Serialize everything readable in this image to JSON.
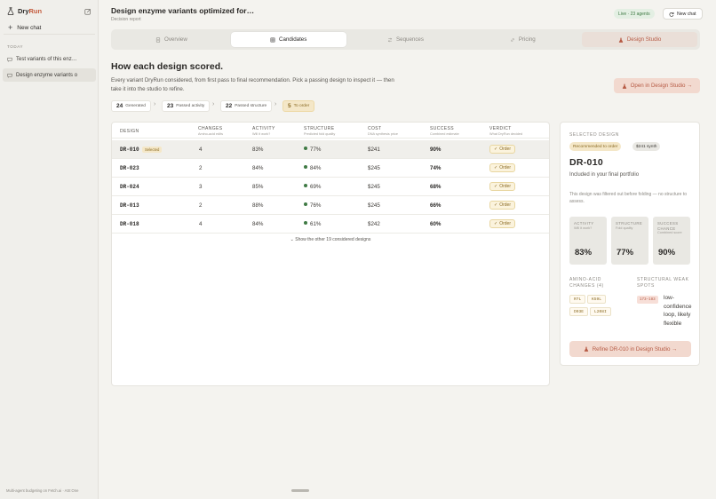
{
  "app": {
    "name_prefix": "Dry",
    "name_suffix": "Run",
    "new_chat": "New chat",
    "today_label": "TODAY",
    "history": [
      {
        "label": "Test variants of this enz…"
      },
      {
        "label": "Design enzyme variants o"
      }
    ],
    "footer": "Multi-agent budgeting on Fetch.ai · ASI:One"
  },
  "header": {
    "title": "Design enzyme variants optimized for…",
    "subtitle": "Decision report",
    "live_badge": "Live · 23 agents",
    "new_chat": "New chat"
  },
  "tabs": [
    {
      "label": "Overview",
      "icon": "document-icon"
    },
    {
      "label": "Candidates",
      "icon": "grid-icon"
    },
    {
      "label": "Sequences",
      "icon": "swap-icon"
    },
    {
      "label": "Pricing",
      "icon": "link-icon"
    },
    {
      "label": "Design Studio",
      "icon": "flask-icon"
    }
  ],
  "section": {
    "heading": "How each design scored.",
    "description": "Every variant DryRun considered, from first pass to final recommendation. Pick a passing design to inspect it — then take it into the studio to refine.",
    "open_studio": "Open in Design Studio →"
  },
  "funnel": [
    {
      "count": "24",
      "label": "Generated"
    },
    {
      "count": "23",
      "label": "Passed activity"
    },
    {
      "count": "22",
      "label": "Passed structure"
    },
    {
      "count": "5",
      "label": "To order"
    }
  ],
  "table": {
    "columns": [
      {
        "label": "DESIGN",
        "sub": ""
      },
      {
        "label": "CHANGES",
        "sub": "Amino-acid edits"
      },
      {
        "label": "ACTIVITY",
        "sub": "Will it work?"
      },
      {
        "label": "STRUCTURE",
        "sub": "Predicted fold quality"
      },
      {
        "label": "COST",
        "sub": "DNA synthesis price"
      },
      {
        "label": "SUCCESS",
        "sub": "Combined estimate"
      },
      {
        "label": "VERDICT",
        "sub": "What DryRun decided"
      }
    ],
    "selected_badge": "Selected",
    "rows": [
      {
        "id": "DR-010",
        "changes": "4",
        "activity": "83%",
        "structure": "77%",
        "cost": "$241",
        "success": "90%",
        "verdict": "Order"
      },
      {
        "id": "DR-023",
        "changes": "2",
        "activity": "84%",
        "structure": "84%",
        "cost": "$245",
        "success": "74%",
        "verdict": "Order"
      },
      {
        "id": "DR-024",
        "changes": "3",
        "activity": "85%",
        "structure": "69%",
        "cost": "$245",
        "success": "68%",
        "verdict": "Order"
      },
      {
        "id": "DR-013",
        "changes": "2",
        "activity": "88%",
        "structure": "76%",
        "cost": "$245",
        "success": "66%",
        "verdict": "Order"
      },
      {
        "id": "DR-018",
        "changes": "4",
        "activity": "84%",
        "structure": "61%",
        "cost": "$242",
        "success": "60%",
        "verdict": "Order"
      }
    ],
    "show_more": "Show the other 19 considered designs"
  },
  "detail": {
    "label": "SELECTED DESIGN",
    "badge_recommended": "Recommended to order",
    "badge_price": "$241 synth",
    "id": "DR-010",
    "subtitle": "Included in your final portfolio",
    "note": "This design was filtered out before folding — no structure to assess.",
    "metrics": [
      {
        "label": "ACTIVITY",
        "sub": "Will it work?",
        "value": "83%"
      },
      {
        "label": "STRUCTURE",
        "sub": "Fold quality",
        "value": "77%"
      },
      {
        "label": "SUCCESS CHANCE",
        "sub": "Combined score",
        "value": "90%"
      }
    ],
    "changes_label": "AMINO-ACID CHANGES (4)",
    "changes": [
      "R7L",
      "K59L",
      "D93E",
      "L208I"
    ],
    "weak_label": "STRUCTURAL WEAK SPOTS",
    "weak_spot": "173–183",
    "weak_text": "low-confidence loop, likely flexible",
    "refine": "Refine DR-010 in Design Studio →"
  }
}
